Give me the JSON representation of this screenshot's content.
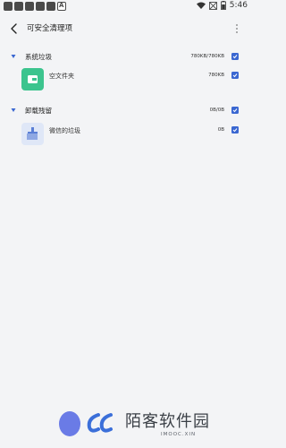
{
  "status_bar": {
    "time": "5:46"
  },
  "app_bar": {
    "title": "可安全清理项"
  },
  "groups": [
    {
      "label": "系统垃圾",
      "size": "780KB/780KB",
      "checked": true,
      "items": [
        {
          "label": "空文件夹",
          "size": "780KB",
          "checked": true,
          "icon": "folder-icon",
          "icon_color": "#3cc48e"
        }
      ]
    },
    {
      "label": "卸载残留",
      "size": "0B/0B",
      "checked": true,
      "items": [
        {
          "label": "微信的垃圾",
          "size": "0B",
          "checked": true,
          "icon": "broom-icon",
          "icon_color": "#dfe7f7"
        }
      ]
    }
  ],
  "watermark": {
    "title": "陌客软件园",
    "subtitle": "IMOOC.XIN"
  },
  "colors": {
    "background": "#f3f4f6",
    "accent": "#3a67d1",
    "folder_icon": "#3cc48e"
  }
}
